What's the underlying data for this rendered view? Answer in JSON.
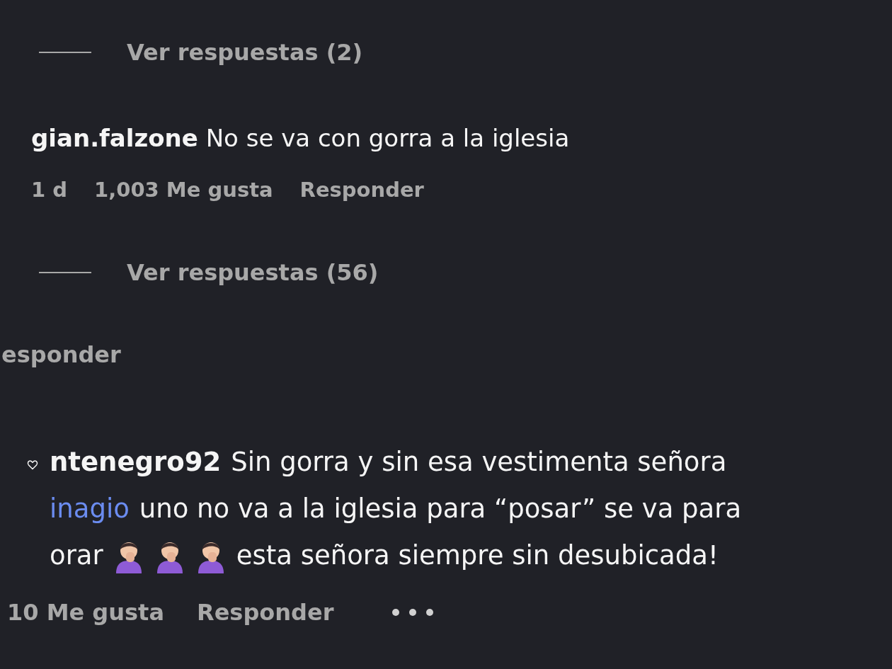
{
  "top_replies": {
    "label": "Ver respuestas (2)"
  },
  "comment": {
    "username": "gian.falzone",
    "text": "No se va con gorra a la iglesia",
    "time": "1 d",
    "likes": "1,003 Me gusta",
    "reply": "Responder"
  },
  "replies_toggle": {
    "label": "Ver respuestas (56)"
  },
  "cut_reply": "esponder",
  "bottom_comment": {
    "lines": [
      [
        {
          "kind": "username",
          "text": "ntenegro92"
        },
        {
          "kind": "text",
          "text": "Sin gorra y sin esa vestimenta señora"
        }
      ],
      [
        {
          "kind": "mention",
          "text": "inagio"
        },
        {
          "kind": "text",
          "text": "uno no va a la iglesia para “posar” se va para"
        }
      ],
      [
        {
          "kind": "text",
          "text": "orar"
        },
        {
          "kind": "emoji"
        },
        {
          "kind": "emoji"
        },
        {
          "kind": "emoji"
        },
        {
          "kind": "text",
          "text": "esta señora siempre sin desubicada!"
        }
      ]
    ],
    "likes": "10 Me gusta",
    "reply": "Responder"
  }
}
